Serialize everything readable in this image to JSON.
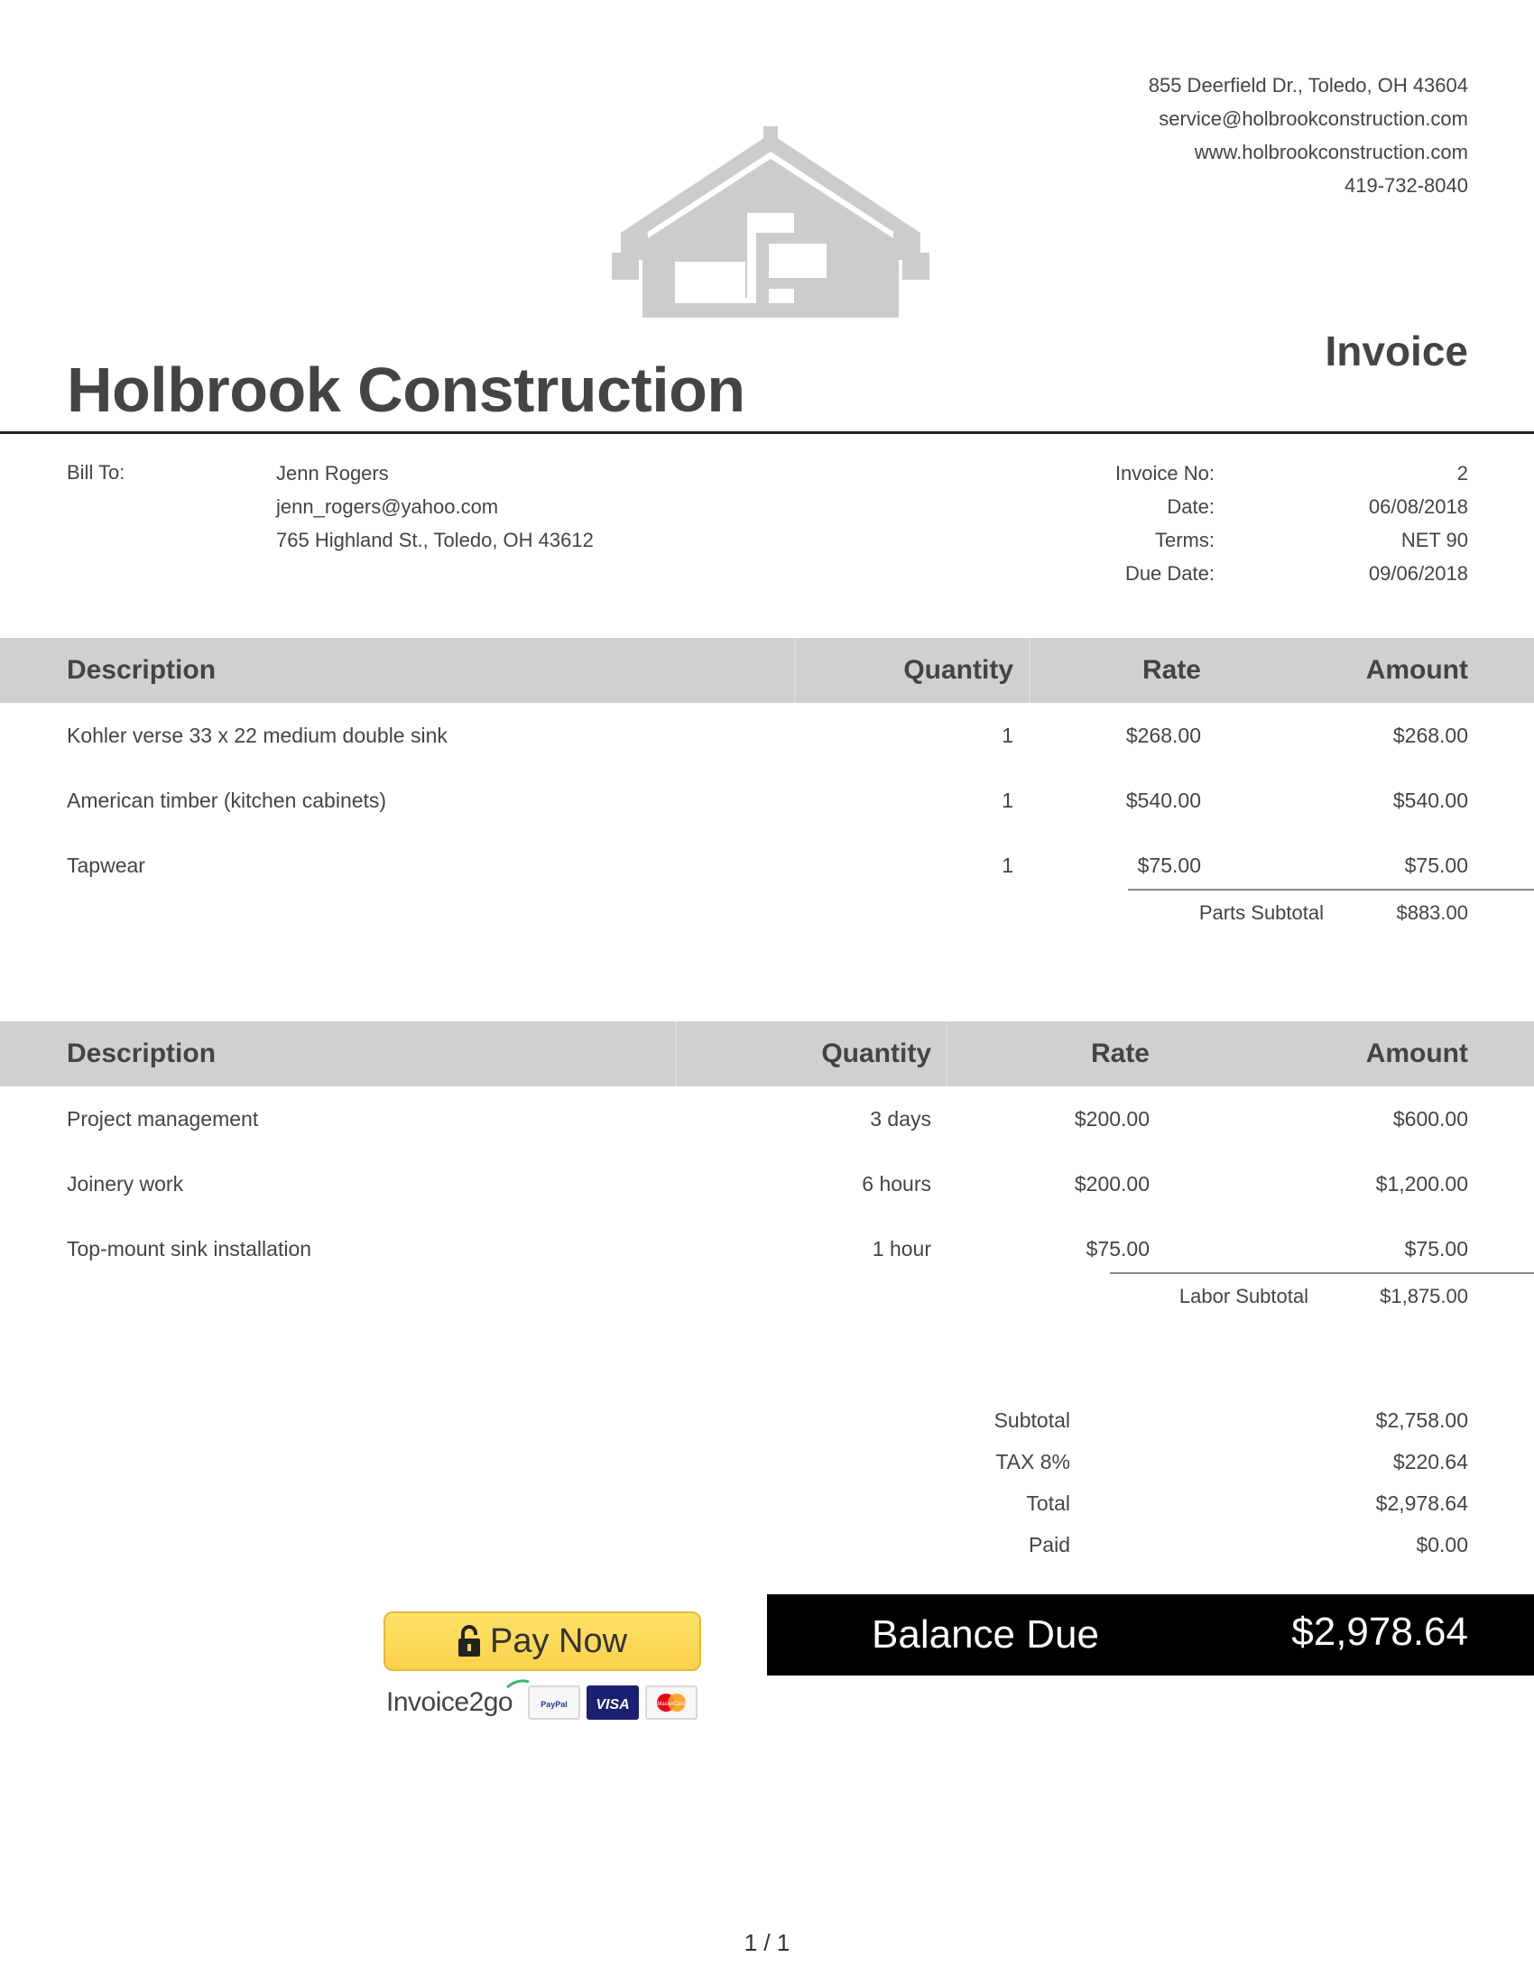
{
  "company": {
    "name": "Holbrook Construction",
    "address": "855 Deerfield Dr., Toledo, OH 43604",
    "email": "service@holbrookconstruction.com",
    "website": "www.holbrookconstruction.com",
    "phone": "419-732-8040",
    "logo_icon": "house-logo-icon"
  },
  "document_title": "Invoice",
  "bill_to": {
    "label": "Bill To:",
    "name": "Jenn Rogers",
    "email": "jenn_rogers@yahoo.com",
    "address": "765 Highland St., Toledo, OH 43612"
  },
  "meta": [
    {
      "label": "Invoice No:",
      "value": "2"
    },
    {
      "label": "Date:",
      "value": "06/08/2018"
    },
    {
      "label": "Terms:",
      "value": "NET 90"
    },
    {
      "label": "Due Date:",
      "value": "09/06/2018"
    }
  ],
  "parts_table": {
    "headers": {
      "description": "Description",
      "quantity": "Quantity",
      "rate": "Rate",
      "amount": "Amount"
    },
    "rows": [
      {
        "description": "Kohler verse 33 x 22 medium double sink",
        "quantity": "1",
        "rate": "$268.00",
        "amount": "$268.00"
      },
      {
        "description": "American timber (kitchen cabinets)",
        "quantity": "1",
        "rate": "$540.00",
        "amount": "$540.00"
      },
      {
        "description": "Tapwear",
        "quantity": "1",
        "rate": "$75.00",
        "amount": "$75.00"
      }
    ],
    "subtotal_label": "Parts Subtotal",
    "subtotal_value": "$883.00"
  },
  "labor_table": {
    "headers": {
      "description": "Description",
      "quantity": "Quantity",
      "rate": "Rate",
      "amount": "Amount"
    },
    "rows": [
      {
        "description": "Project management",
        "quantity": "3 days",
        "rate": "$200.00",
        "amount": "$600.00"
      },
      {
        "description": "Joinery work",
        "quantity": "6 hours",
        "rate": "$200.00",
        "amount": "$1,200.00"
      },
      {
        "description": "Top-mount sink installation",
        "quantity": "1 hour",
        "rate": "$75.00",
        "amount": "$75.00"
      }
    ],
    "subtotal_label": "Labor Subtotal",
    "subtotal_value": "$1,875.00"
  },
  "summary": [
    {
      "label": "Subtotal",
      "value": "$2,758.00"
    },
    {
      "label": "TAX 8%",
      "value": "$220.64"
    },
    {
      "label": "Total",
      "value": "$2,978.64"
    },
    {
      "label": "Paid",
      "value": "$0.00"
    }
  ],
  "balance_due": {
    "label": "Balance Due",
    "value": "$2,978.64"
  },
  "payment": {
    "button_label": "Pay Now",
    "lock_icon": "lock-icon",
    "brand_prefix": "Invoice",
    "brand_suffix": "2go",
    "cards": [
      {
        "name": "PayPal",
        "icon": "paypal-icon",
        "label": "PayPal"
      },
      {
        "name": "Visa",
        "icon": "visa-icon",
        "label": "VISA"
      },
      {
        "name": "MasterCard",
        "icon": "mastercard-icon",
        "label": "MasterCard"
      }
    ]
  },
  "page_counter": "1 / 1",
  "colors": {
    "header_bg": "#d0d0d0",
    "balance_bg": "#000000",
    "pay_button": "#fcd24d",
    "text": "#444444"
  }
}
